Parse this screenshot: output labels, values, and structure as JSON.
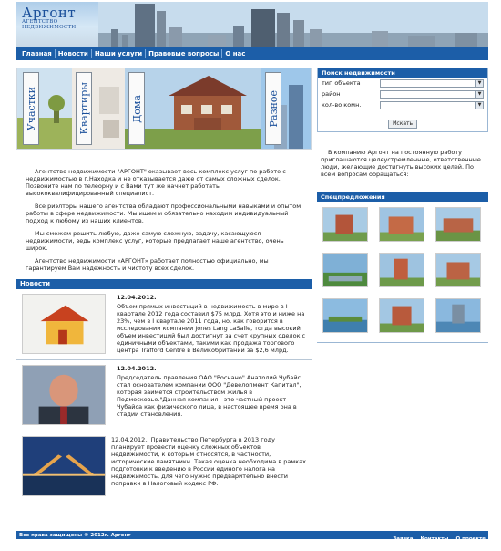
{
  "header": {
    "logo_title": "Аргонт",
    "logo_subtitle": "АГЕНТСТВО НЕДВИЖИМОСТИ"
  },
  "nav": [
    "Главная",
    "Новости",
    "Наши услуги",
    "Правовые вопросы",
    "О нас"
  ],
  "banner": {
    "tabs": [
      "Участки",
      "Квартиры",
      "Дома",
      "Разное"
    ]
  },
  "intro": [
    "Агентство недвижимости \"АРГОНТ\" оказывает весь комплекс услуг по работе с недвижимостью в г.Находка и не отказывается даже от самых сложных сделок. Позвоните нам по телеорну и с Вами тут же начнет работать высококвалифицированный специалист.",
    "Все риэлторы нашего агентства обладают профессиональными навыками и опытом работы в сфере недвижимости. Мы ищем и обязательно находим индивидуальный подход к любому из наших клиентов.",
    "Мы сможем решить любую, даже самую сложную, задачу, касающуюся недвижимости, ведь комплекс услуг, которые предлагает наше агентство, очень широк.",
    "Агентство недвижимости «АРГОНТ» работает полностью официально, мы гарантируем Вам надежность и чистоту всех сделок."
  ],
  "news": {
    "title": "Новости",
    "items": [
      {
        "date": "12.04.2012.",
        "text": "Объем прямых инвестиций в недвижимость в мире в I квартале 2012 года составил $75 млрд. Хотя это и ниже на 23%, чем в I квартале 2011 года, но, как говорится в исследовании компании Jones Lang LaSalle, тогда высокий объем инвестиций был достигнут за счет крупных сделок с единичными объектами, такими как продажа торгового центра Trafford Centre в Великобритании за $2,6 млрд."
      },
      {
        "date": "12.04.2012.",
        "text": "Председатель правления ОАО \"Роснано\" Анатолий Чубайс стал основателем компании ООО \"Девелопмент Капитал\", которая займется строительством жилья в Подмосковье.\"Данная компания - это частный проект Чубайса как физического лица, в настоящее время она в стадии становления."
      },
      {
        "date": "12.04.2012.",
        "text": "Правительство Петербурга в 2013 году планирует провести оценку сложных объектов недвижимости, к которым относятся, в частности, исторические памятники. Такая оценка необходима в рамках подготовки к введению в России единого налога на недвижимость, для чего нужно предварительно внести поправки в Налоговый кодекс РФ."
      }
    ]
  },
  "search": {
    "title": "Поиск недвижимости",
    "fields": [
      "тип объекта",
      "район",
      "кол-во комн."
    ],
    "button": "Искать"
  },
  "invite": "В компанию Аргонт на постоянную работу приглашаются целеустремленные, ответственные люди, желающие достигнуть высоких целей. По всем вопросам обращаться:",
  "specials": {
    "title": "Спецпредложения"
  },
  "footer": {
    "copyright": "Все права защищены © 2012г. Аргонт",
    "links": [
      "Заявка",
      "Контакты",
      "О проекте"
    ]
  },
  "colors": {
    "accent": "#1c5ea8",
    "logo": "#1a4f9a"
  }
}
